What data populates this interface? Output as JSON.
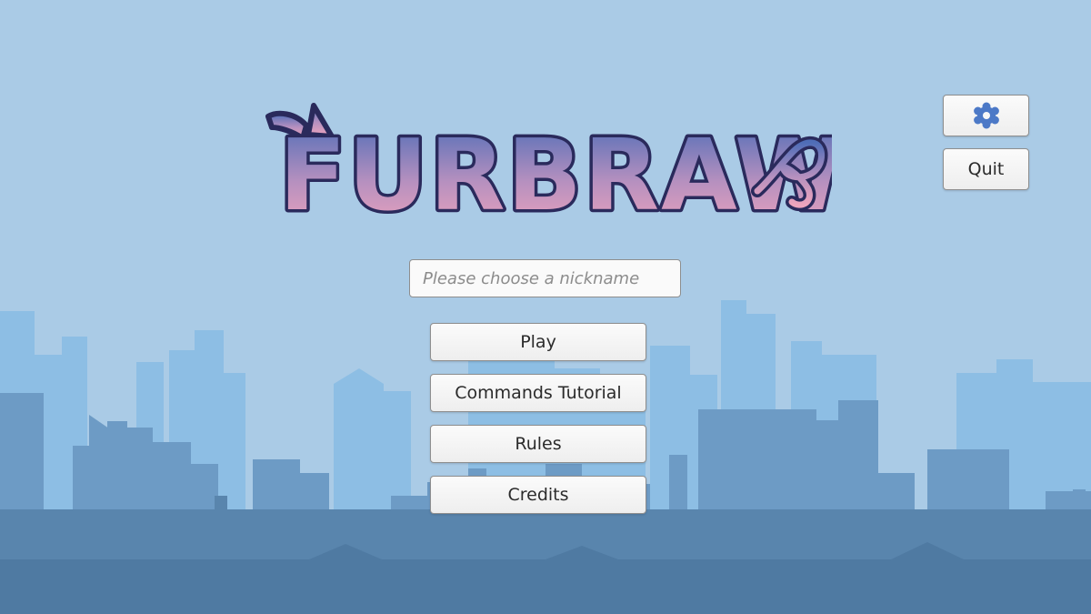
{
  "game": {
    "logo_text": "FURBRAW"
  },
  "colors": {
    "sky": "#aacbe6",
    "city_far": "#8cbde4",
    "city_mid": "#6c9ac4",
    "city_near": "#5682aa",
    "logo_outline": "#2a2a5c",
    "logo_top": "#5170b8",
    "logo_bottom": "#eaa2bd",
    "gear": "#4c79c7"
  },
  "top_right": {
    "settings_icon": "gear-icon",
    "quit_label": "Quit"
  },
  "nickname": {
    "value": "",
    "placeholder": "Please choose a nickname"
  },
  "menu": {
    "play_label": "Play",
    "tutorial_label": "Commands Tutorial",
    "rules_label": "Rules",
    "credits_label": "Credits"
  }
}
